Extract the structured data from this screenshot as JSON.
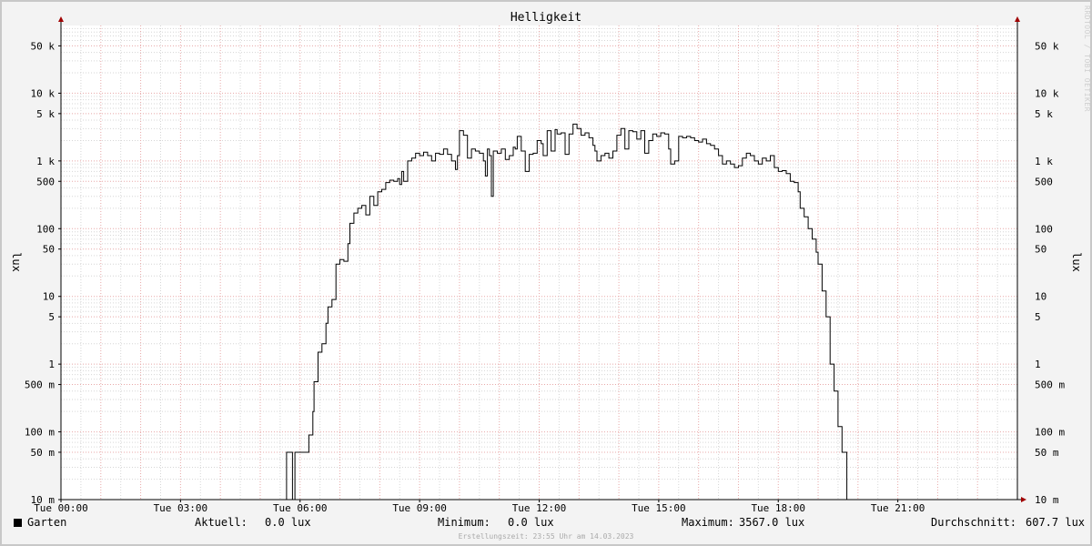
{
  "chart_data": {
    "type": "line",
    "title": "Helligkeit",
    "ylabel": "lux",
    "ylabel_right": "lux",
    "yscale": "log",
    "ylim": [
      0.01,
      100000
    ],
    "xlim_hours": [
      0,
      24
    ],
    "grid": true,
    "y_ticks": [
      {
        "value": 0.01,
        "label": "10 m"
      },
      {
        "value": 0.05,
        "label": "50 m"
      },
      {
        "value": 0.1,
        "label": "100 m"
      },
      {
        "value": 0.5,
        "label": "500 m"
      },
      {
        "value": 1,
        "label": "1"
      },
      {
        "value": 5,
        "label": "5"
      },
      {
        "value": 10,
        "label": "10"
      },
      {
        "value": 50,
        "label": "50"
      },
      {
        "value": 100,
        "label": "100"
      },
      {
        "value": 500,
        "label": "500"
      },
      {
        "value": 1000,
        "label": "1 k"
      },
      {
        "value": 5000,
        "label": "5 k"
      },
      {
        "value": 10000,
        "label": "10 k"
      },
      {
        "value": 50000,
        "label": "50 k"
      }
    ],
    "x_ticks": [
      {
        "hour": 0,
        "label": "Tue 00:00"
      },
      {
        "hour": 3,
        "label": "Tue 03:00"
      },
      {
        "hour": 6,
        "label": "Tue 06:00"
      },
      {
        "hour": 9,
        "label": "Tue 09:00"
      },
      {
        "hour": 12,
        "label": "Tue 12:00"
      },
      {
        "hour": 15,
        "label": "Tue 15:00"
      },
      {
        "hour": 18,
        "label": "Tue 18:00"
      },
      {
        "hour": 21,
        "label": "Tue 21:00"
      }
    ],
    "series": [
      {
        "name": "Garten",
        "color": "#000000",
        "points": [
          [
            0.0,
            0.0
          ],
          [
            5.65,
            0.0
          ],
          [
            5.66,
            0.05
          ],
          [
            5.8,
            0.05
          ],
          [
            5.81,
            0.0
          ],
          [
            5.86,
            0.0
          ],
          [
            5.87,
            0.05
          ],
          [
            6.05,
            0.05
          ],
          [
            6.1,
            0.05
          ],
          [
            6.2,
            0.05
          ],
          [
            6.22,
            0.09
          ],
          [
            6.32,
            0.2
          ],
          [
            6.35,
            0.55
          ],
          [
            6.45,
            1.5
          ],
          [
            6.55,
            2
          ],
          [
            6.65,
            4
          ],
          [
            6.7,
            7
          ],
          [
            6.8,
            9
          ],
          [
            6.9,
            30
          ],
          [
            7.0,
            35
          ],
          [
            7.1,
            33
          ],
          [
            7.2,
            60
          ],
          [
            7.25,
            120
          ],
          [
            7.35,
            170
          ],
          [
            7.45,
            200
          ],
          [
            7.55,
            220
          ],
          [
            7.65,
            160
          ],
          [
            7.75,
            300
          ],
          [
            7.85,
            220
          ],
          [
            7.95,
            350
          ],
          [
            8.05,
            380
          ],
          [
            8.15,
            480
          ],
          [
            8.25,
            520
          ],
          [
            8.35,
            500
          ],
          [
            8.45,
            550
          ],
          [
            8.5,
            450
          ],
          [
            8.55,
            700
          ],
          [
            8.6,
            500
          ],
          [
            8.7,
            1000
          ],
          [
            8.8,
            1100
          ],
          [
            8.9,
            1300
          ],
          [
            9.0,
            1200
          ],
          [
            9.1,
            1350
          ],
          [
            9.2,
            1200
          ],
          [
            9.3,
            1000
          ],
          [
            9.4,
            1300
          ],
          [
            9.5,
            1250
          ],
          [
            9.6,
            1500
          ],
          [
            9.7,
            1250
          ],
          [
            9.8,
            1000
          ],
          [
            9.9,
            750
          ],
          [
            9.95,
            1200
          ],
          [
            10.0,
            2800
          ],
          [
            10.1,
            2400
          ],
          [
            10.2,
            1100
          ],
          [
            10.3,
            1500
          ],
          [
            10.4,
            1400
          ],
          [
            10.5,
            1300
          ],
          [
            10.6,
            1000
          ],
          [
            10.65,
            600
          ],
          [
            10.7,
            1500
          ],
          [
            10.75,
            1200
          ],
          [
            10.8,
            300
          ],
          [
            10.85,
            1400
          ],
          [
            10.95,
            1300
          ],
          [
            11.05,
            1500
          ],
          [
            11.15,
            1050
          ],
          [
            11.25,
            1200
          ],
          [
            11.35,
            1600
          ],
          [
            11.4,
            1500
          ],
          [
            11.45,
            2300
          ],
          [
            11.55,
            1400
          ],
          [
            11.65,
            700
          ],
          [
            11.75,
            1250
          ],
          [
            11.85,
            1300
          ],
          [
            11.95,
            2000
          ],
          [
            12.05,
            1800
          ],
          [
            12.1,
            1200
          ],
          [
            12.2,
            2800
          ],
          [
            12.3,
            1400
          ],
          [
            12.4,
            2900
          ],
          [
            12.45,
            2500
          ],
          [
            12.55,
            2600
          ],
          [
            12.65,
            1250
          ],
          [
            12.75,
            2500
          ],
          [
            12.85,
            3500
          ],
          [
            12.95,
            3000
          ],
          [
            13.05,
            2400
          ],
          [
            13.15,
            2600
          ],
          [
            13.25,
            2200
          ],
          [
            13.35,
            1700
          ],
          [
            13.4,
            1400
          ],
          [
            13.45,
            1000
          ],
          [
            13.55,
            1200
          ],
          [
            13.65,
            1300
          ],
          [
            13.75,
            1100
          ],
          [
            13.85,
            1400
          ],
          [
            13.95,
            2400
          ],
          [
            14.05,
            3000
          ],
          [
            14.15,
            1500
          ],
          [
            14.25,
            2800
          ],
          [
            14.35,
            2700
          ],
          [
            14.45,
            2100
          ],
          [
            14.55,
            2800
          ],
          [
            14.65,
            1300
          ],
          [
            14.75,
            2000
          ],
          [
            14.85,
            2500
          ],
          [
            14.95,
            2300
          ],
          [
            15.05,
            2600
          ],
          [
            15.15,
            2500
          ],
          [
            15.25,
            1500
          ],
          [
            15.3,
            900
          ],
          [
            15.4,
            1000
          ],
          [
            15.5,
            2300
          ],
          [
            15.6,
            2200
          ],
          [
            15.7,
            2300
          ],
          [
            15.8,
            2200
          ],
          [
            15.9,
            2000
          ],
          [
            16.0,
            1900
          ],
          [
            16.1,
            2100
          ],
          [
            16.2,
            1800
          ],
          [
            16.3,
            1700
          ],
          [
            16.4,
            1500
          ],
          [
            16.5,
            1200
          ],
          [
            16.6,
            900
          ],
          [
            16.7,
            1000
          ],
          [
            16.8,
            900
          ],
          [
            16.9,
            800
          ],
          [
            17.0,
            850
          ],
          [
            17.1,
            1100
          ],
          [
            17.2,
            1300
          ],
          [
            17.3,
            1200
          ],
          [
            17.4,
            1000
          ],
          [
            17.5,
            900
          ],
          [
            17.6,
            1100
          ],
          [
            17.7,
            1000
          ],
          [
            17.8,
            1200
          ],
          [
            17.9,
            800
          ],
          [
            18.0,
            700
          ],
          [
            18.1,
            720
          ],
          [
            18.2,
            650
          ],
          [
            18.3,
            500
          ],
          [
            18.4,
            480
          ],
          [
            18.5,
            350
          ],
          [
            18.55,
            200
          ],
          [
            18.65,
            150
          ],
          [
            18.75,
            100
          ],
          [
            18.85,
            70
          ],
          [
            18.95,
            45
          ],
          [
            19.0,
            30
          ],
          [
            19.1,
            12
          ],
          [
            19.2,
            5
          ],
          [
            19.3,
            1
          ],
          [
            19.4,
            0.4
          ],
          [
            19.5,
            0.12
          ],
          [
            19.6,
            0.05
          ],
          [
            19.7,
            0.05
          ],
          [
            19.72,
            0.0
          ],
          [
            24.0,
            0.0
          ]
        ]
      }
    ]
  },
  "legend": {
    "series_name": "Garten",
    "current_label": "Aktuell:",
    "current_value": "0.0 lux",
    "min_label": "Minimum:",
    "min_value": "0.0 lux",
    "max_label": "Maximum:",
    "max_value": "3567.0 lux",
    "avg_label": "Durchschnitt:",
    "avg_value": "607.7 lux"
  },
  "footer": "Erstellungszeit: 23:55 Uhr am 14.03.2023",
  "watermark": "RRDTOOL / TOBI OETIKER"
}
